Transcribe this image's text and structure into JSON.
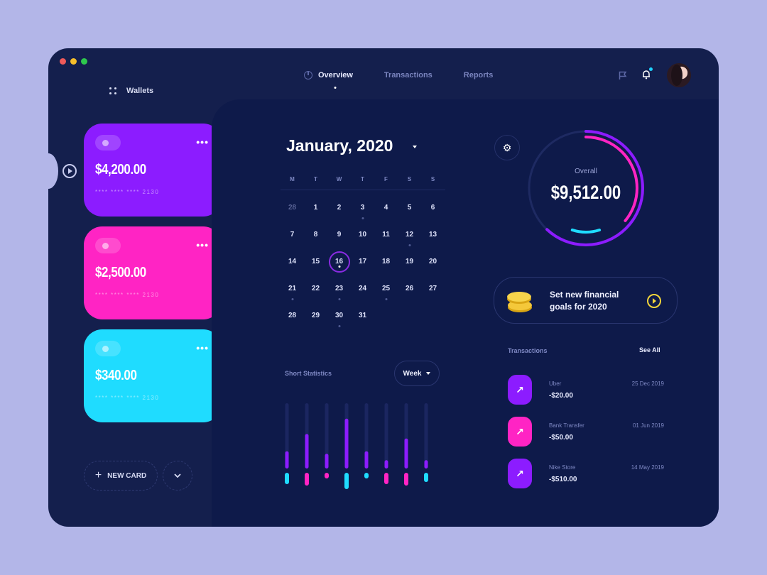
{
  "window": {
    "traffic_lights": [
      {
        "name": "close",
        "color": "#ef5a5a"
      },
      {
        "name": "minimize",
        "color": "#f6be2b"
      },
      {
        "name": "maximize",
        "color": "#2ec84d"
      }
    ]
  },
  "sidebar": {
    "title": "Wallets",
    "icon": "grid-icon",
    "cards": [
      {
        "amount": "$4,200.00",
        "number": "**** **** **** 2130",
        "color": "#8c1cff"
      },
      {
        "amount": "$2,500.00",
        "number": "**** **** **** 2130",
        "color": "#ff24c4"
      },
      {
        "amount": "$340.00",
        "number": "**** **** **** 2130",
        "color": "#1fdcff"
      }
    ],
    "new_card_label": "NEW CARD",
    "more_label": "⌄"
  },
  "nav": {
    "items": [
      {
        "label": "Overview",
        "active": true
      },
      {
        "label": "Transactions",
        "active": false
      },
      {
        "label": "Reports",
        "active": false
      }
    ],
    "notification_dot_color": "#1fd3ff"
  },
  "calendar": {
    "title": "January, 2020",
    "weekdays": [
      "M",
      "T",
      "W",
      "T",
      "F",
      "S",
      "S"
    ],
    "selected_day": 16,
    "hovered_day": 11,
    "days": [
      {
        "d": "28",
        "muted": true
      },
      {
        "d": "1"
      },
      {
        "d": "2"
      },
      {
        "d": "3",
        "dot": true
      },
      {
        "d": "4"
      },
      {
        "d": "5"
      },
      {
        "d": "6"
      },
      {
        "d": "7"
      },
      {
        "d": "8"
      },
      {
        "d": "9"
      },
      {
        "d": "10"
      },
      {
        "d": "11",
        "hover": true
      },
      {
        "d": "12",
        "dot": true
      },
      {
        "d": "13"
      },
      {
        "d": "14"
      },
      {
        "d": "15"
      },
      {
        "d": "16",
        "selected": true,
        "dot": true
      },
      {
        "d": "17"
      },
      {
        "d": "18"
      },
      {
        "d": "19"
      },
      {
        "d": "20"
      },
      {
        "d": "21",
        "dot": true
      },
      {
        "d": "22"
      },
      {
        "d": "23",
        "dot": true
      },
      {
        "d": "24"
      },
      {
        "d": "25",
        "dot": true
      },
      {
        "d": "26"
      },
      {
        "d": "27"
      },
      {
        "d": "28"
      },
      {
        "d": "29"
      },
      {
        "d": "30",
        "dot": true
      },
      {
        "d": "31"
      }
    ]
  },
  "overall": {
    "label": "Overall",
    "amount": "$9,512.00",
    "segments": [
      {
        "name": "purple",
        "color": "#8c1cff",
        "fraction": 0.62
      },
      {
        "name": "pink",
        "color": "#ff24c4",
        "fraction": 0.36
      },
      {
        "name": "cyan",
        "color": "#1fdcff",
        "fraction": 0.1
      }
    ]
  },
  "goal": {
    "text_line1": "Set new financial",
    "text_line2": "goals for 2020"
  },
  "transactions": {
    "title": "Transactions",
    "see_all": "See All",
    "items": [
      {
        "name": "Uber",
        "amount": "-$20.00",
        "date": "25 Dec 2019",
        "color": "#8c1cff"
      },
      {
        "name": "Bank Transfer",
        "amount": "-$50.00",
        "date": "01 Jun 2019",
        "color": "#ff24c4"
      },
      {
        "name": "Nike Store",
        "amount": "-$510.00",
        "date": "14 May 2019",
        "color": "#8c1cff"
      }
    ]
  },
  "stats": {
    "title": "Short Statistics",
    "period": "Week",
    "bars": [
      {
        "top": 0.27,
        "bottom": 0.16,
        "bottom_color": "#1fdcff"
      },
      {
        "top": 0.54,
        "bottom": 0.18,
        "bottom_color": "#ff24c4"
      },
      {
        "top": 0.23,
        "bottom": 0.08,
        "bottom_color": "#ff24c4"
      },
      {
        "top": 0.78,
        "bottom": 0.23,
        "bottom_color": "#1fdcff"
      },
      {
        "top": 0.27,
        "bottom": 0.08,
        "bottom_color": "#1fdcff"
      },
      {
        "top": 0.13,
        "bottom": 0.16,
        "bottom_color": "#ff24c4"
      },
      {
        "top": 0.47,
        "bottom": 0.18,
        "bottom_color": "#ff24c4"
      },
      {
        "top": 0.13,
        "bottom": 0.13,
        "bottom_color": "#1fdcff"
      }
    ]
  }
}
